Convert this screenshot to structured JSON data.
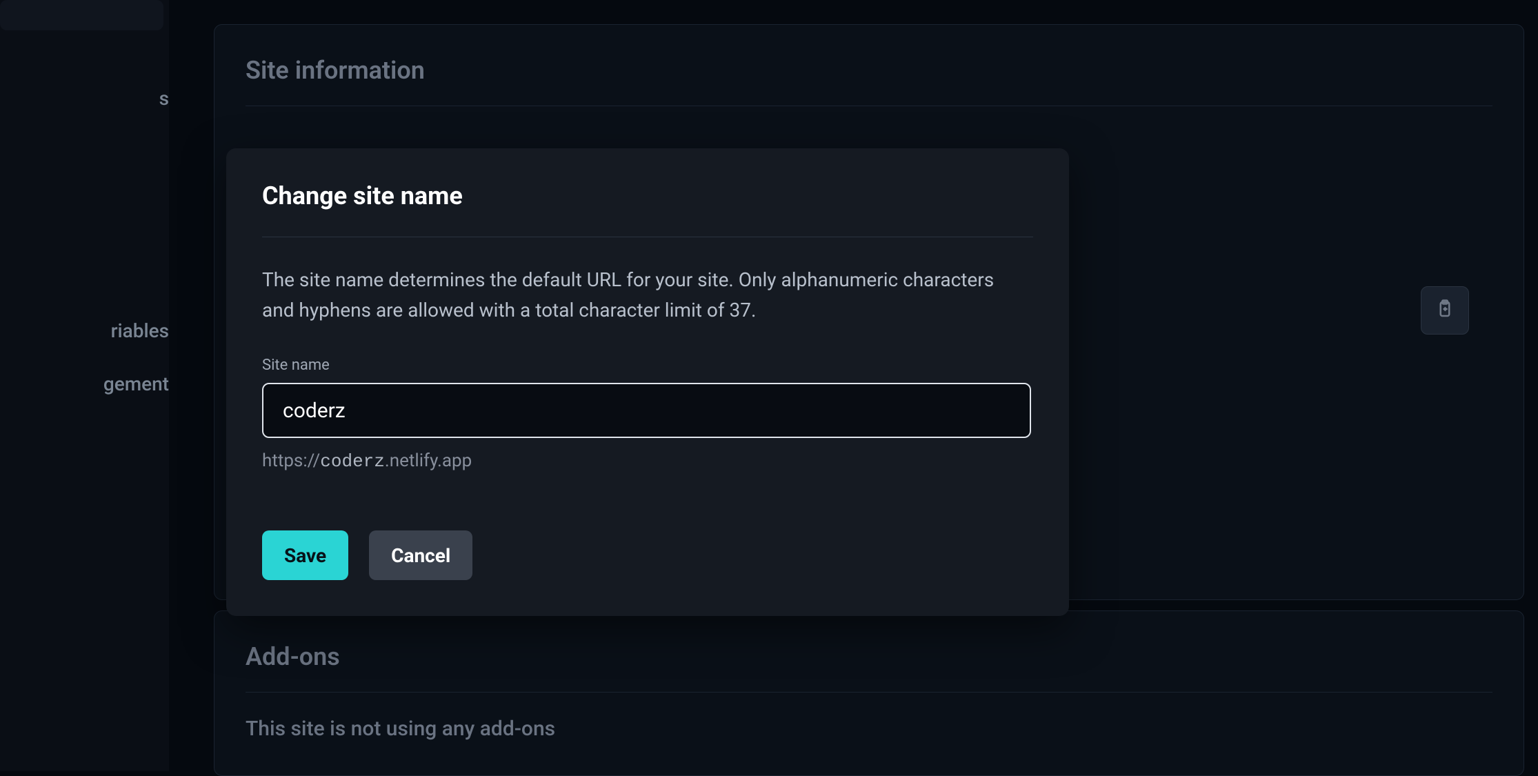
{
  "sidebar": {
    "items": [
      {
        "label": "s"
      },
      {
        "label": "riables"
      },
      {
        "label": "gement"
      }
    ]
  },
  "sections": {
    "site_info": {
      "heading": "Site information"
    },
    "addons": {
      "heading": "Add-ons",
      "empty_text": "This site is not using any add-ons"
    }
  },
  "modal": {
    "title": "Change site name",
    "description": "The site name determines the default URL for your site. Only alphanumeric characters and hyphens are allowed with a total character limit of 37.",
    "field_label": "Site name",
    "input_value": "coderz",
    "url_prefix": "https://",
    "url_slug": "coderz",
    "url_suffix": ".netlify.app",
    "save_label": "Save",
    "cancel_label": "Cancel"
  },
  "icons": {
    "clipboard": "clipboard-import-icon"
  }
}
